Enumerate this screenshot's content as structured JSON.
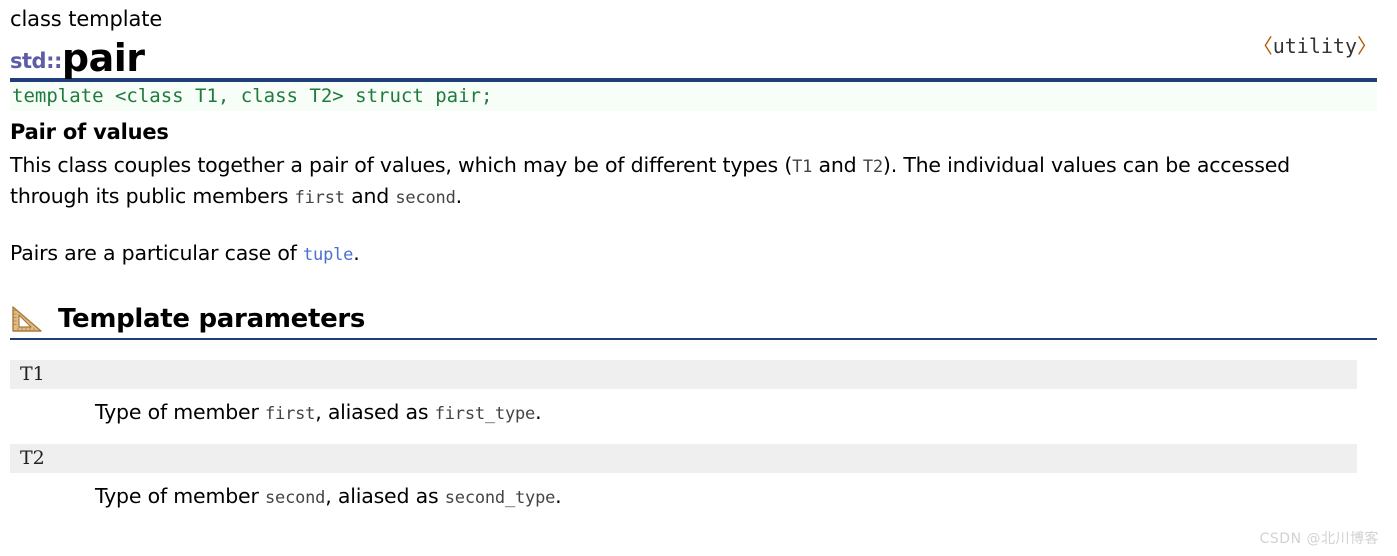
{
  "header": {
    "eyebrow": "class template",
    "namespace": "std::",
    "name": "pair",
    "header_file": "<utility>",
    "header_file_open": "‹",
    "header_file_close": "›"
  },
  "prototype": {
    "code": "template <class T1, class T2> struct pair;"
  },
  "description": {
    "heading": "Pair of values",
    "paragraph1_part1": "This class couples together a pair of values, which may be of different types (",
    "paragraph1_code1": "T1",
    "paragraph1_part2": " and ",
    "paragraph1_code2": "T2",
    "paragraph1_part3": "). The individual values can be accessed through its public members ",
    "paragraph1_code3": "first",
    "paragraph1_part4": " and ",
    "paragraph1_code4": "second",
    "paragraph1_part5": ".",
    "paragraph2_part1": "Pairs are a particular case of ",
    "paragraph2_link": "tuple",
    "paragraph2_part2": "."
  },
  "section": {
    "icon": "triangle-ruler-icon",
    "title": "Template parameters"
  },
  "parameters": [
    {
      "term": "T1",
      "def_part1": "Type of member ",
      "def_code1": "first",
      "def_part2": ", aliased as ",
      "def_code2": "first_type",
      "def_part3": "."
    },
    {
      "term": "T2",
      "def_part1": "Type of member ",
      "def_code1": "second",
      "def_part2": ", aliased as ",
      "def_code2": "second_type",
      "def_part3": "."
    }
  ],
  "watermark": {
    "text": "CSDN @北川博客"
  },
  "colors": {
    "rule": "#1f3f7a",
    "namespace": "#5b5ea6",
    "code_green": "#1f7a3d",
    "code_bg": "#f7fdf7",
    "link_blue": "#4a6fd4",
    "header_file": "#b35900",
    "term_bg": "#efefef",
    "inline_code": "#444444"
  }
}
